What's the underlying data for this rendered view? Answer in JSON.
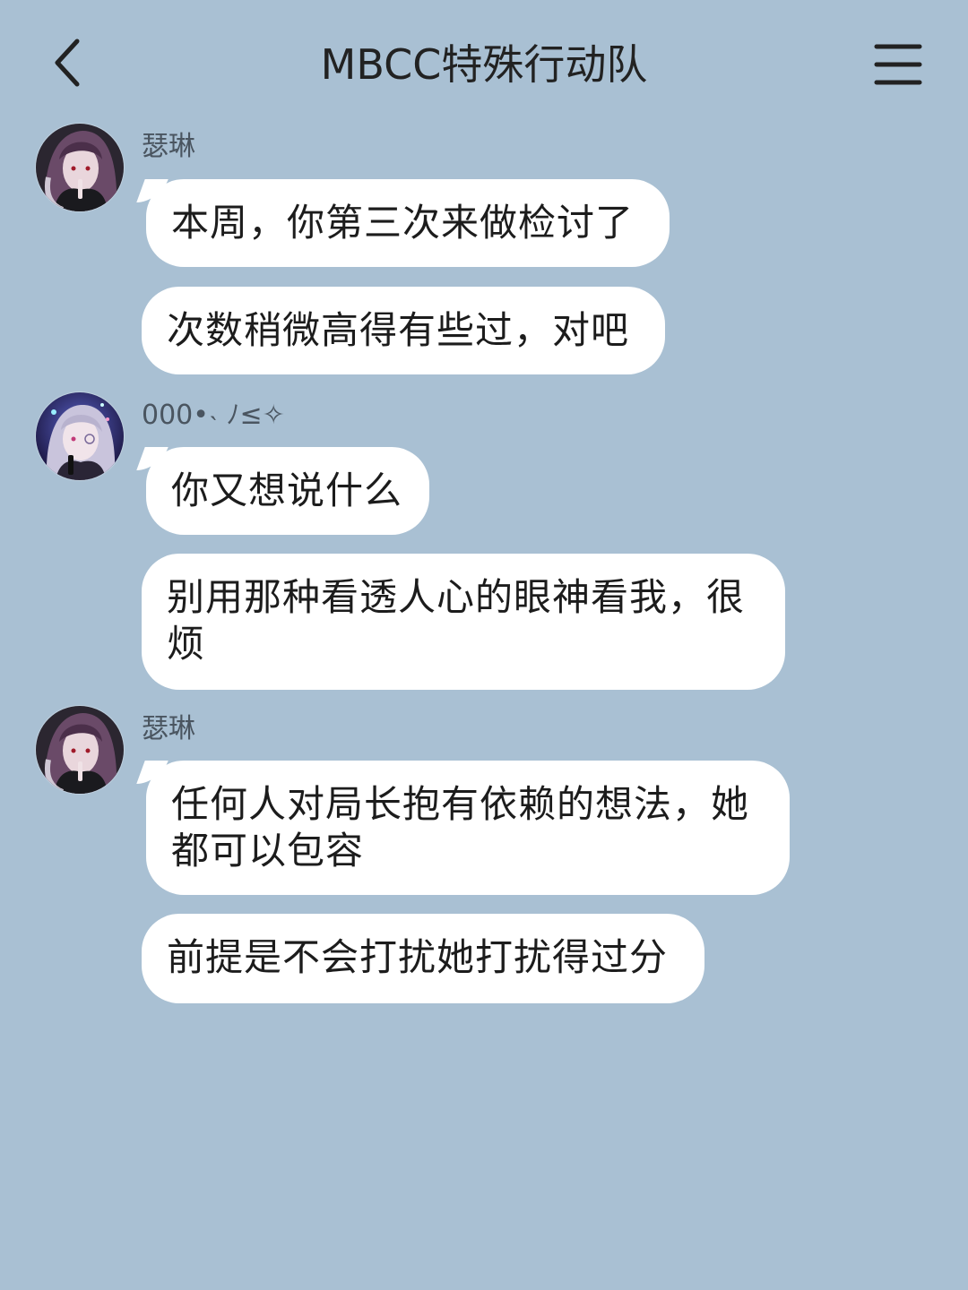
{
  "header": {
    "title": "MBCC特殊行动队"
  },
  "messages": [
    {
      "sender": "瑟琳",
      "avatar": "serin-avatar",
      "bubbles": [
        "本周，你第三次来做检讨了",
        "次数稍微高得有些过，对吧"
      ]
    },
    {
      "sender": "000•˴ ﾉ≤✧",
      "avatar": "user-avatar",
      "bubbles": [
        "你又想说什么",
        "别用那种看透人心的眼神看我，很烦"
      ]
    },
    {
      "sender": "瑟琳",
      "avatar": "serin-avatar",
      "bubbles": [
        "任何人对局长抱有依赖的想法，她都可以包容",
        "前提是不会打扰她打扰得过分"
      ]
    }
  ],
  "colors": {
    "background": "#a9c0d3",
    "bubble": "#ffffff",
    "text": "#1c1c1c"
  }
}
